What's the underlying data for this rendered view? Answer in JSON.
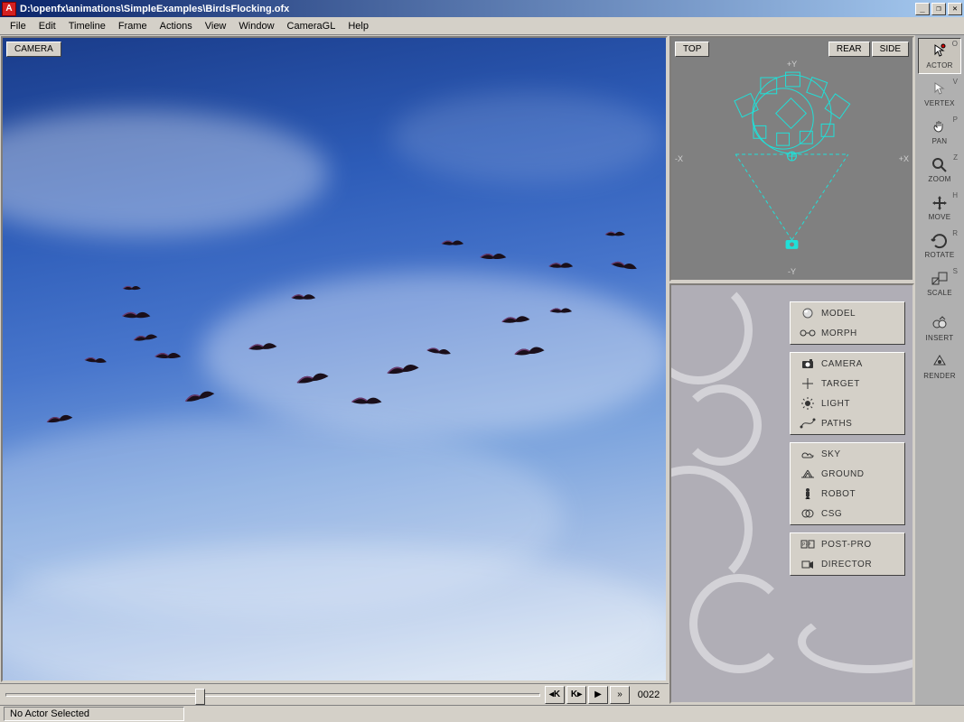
{
  "title": "D:\\openfx\\animations\\SimpleExamples\\BirdsFlocking.ofx",
  "menu": [
    "File",
    "Edit",
    "Timeline",
    "Frame",
    "Actions",
    "View",
    "Window",
    "CameraGL",
    "Help"
  ],
  "viewport": {
    "label": "CAMERA"
  },
  "ortho": {
    "top_btn": "TOP",
    "rear_btn": "REAR",
    "side_btn": "SIDE",
    "axis_py": "+Y",
    "axis_ny": "-Y",
    "axis_nx": "-X",
    "axis_px": "+X"
  },
  "playback": {
    "frame": "0022"
  },
  "status": {
    "text": "No Actor Selected"
  },
  "tools": [
    {
      "label": "ACTOR",
      "key": "O",
      "name": "actor-tool",
      "active": true
    },
    {
      "label": "VERTEX",
      "key": "V",
      "name": "vertex-tool"
    },
    {
      "label": "PAN",
      "key": "P",
      "name": "pan-tool"
    },
    {
      "label": "ZOOM",
      "key": "Z",
      "name": "zoom-tool"
    },
    {
      "label": "MOVE",
      "key": "H",
      "name": "move-tool"
    },
    {
      "label": "ROTATE",
      "key": "R",
      "name": "rotate-tool"
    },
    {
      "label": "SCALE",
      "key": "S",
      "name": "scale-tool"
    },
    {
      "label": "INSERT",
      "key": "",
      "name": "insert-tool"
    },
    {
      "label": "RENDER",
      "key": "",
      "name": "render-tool"
    }
  ],
  "panel_groups": [
    [
      {
        "label": "MODEL",
        "name": "model-button",
        "icon": "sphere"
      },
      {
        "label": "MORPH",
        "name": "morph-button",
        "icon": "morph"
      }
    ],
    [
      {
        "label": "CAMERA",
        "name": "camera-button",
        "icon": "camera"
      },
      {
        "label": "TARGET",
        "name": "target-button",
        "icon": "target"
      },
      {
        "label": "LIGHT",
        "name": "light-button",
        "icon": "light"
      },
      {
        "label": "PATHS",
        "name": "paths-button",
        "icon": "paths"
      }
    ],
    [
      {
        "label": "SKY",
        "name": "sky-button",
        "icon": "sky"
      },
      {
        "label": "GROUND",
        "name": "ground-button",
        "icon": "ground"
      },
      {
        "label": "ROBOT",
        "name": "robot-button",
        "icon": "robot"
      },
      {
        "label": "CSG",
        "name": "csg-button",
        "icon": "csg"
      }
    ],
    [
      {
        "label": "POST-PRO",
        "name": "postpro-button",
        "icon": "postpro"
      },
      {
        "label": "DIRECTOR",
        "name": "director-button",
        "icon": "director"
      }
    ]
  ]
}
